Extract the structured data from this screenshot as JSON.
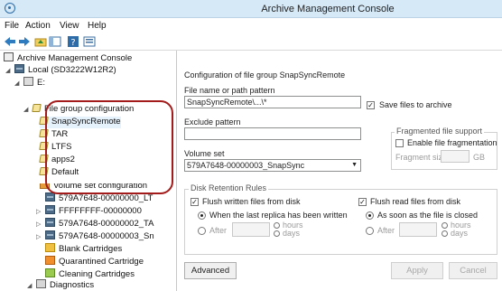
{
  "window": {
    "title": "Archive Management Console"
  },
  "menu": {
    "file": "File",
    "action": "Action",
    "view": "View",
    "help": "Help"
  },
  "toolbar": {
    "back": "arrow-left-icon",
    "forward": "arrow-right-icon",
    "up": "folder-up-icon",
    "show_hide": "show-hide-pane-icon",
    "help": "help-icon",
    "extra": "properties-icon"
  },
  "tree": {
    "root": "Archive Management Console",
    "local": "Local (SD3222W12R2)",
    "drive": "E:",
    "fgc": "File group configuration",
    "items": [
      "SnapSyncRemote",
      "TAR",
      "LTFS",
      "apps2",
      "Default"
    ],
    "volume_set_config": "Volume set configuration",
    "volume_sets": [
      "579A7648-00000000_LT",
      "FFFFFFFF-00000000",
      "579A7648-00000002_TA",
      "579A7648-00000003_Sn"
    ],
    "blank": "Blank Cartridges",
    "quarantined": "Quarantined Cartridge",
    "cleaning": "Cleaning Cartridges",
    "diagnostics": "Diagnostics"
  },
  "form": {
    "heading": "Configuration of file group  SnapSyncRemote",
    "file_name_label": "File name or path pattern",
    "file_name_value": "SnapSyncRemote\\...\\*",
    "save_files_label": "Save files to archive",
    "save_files_checked": true,
    "exclude_label": "Exclude pattern",
    "exclude_value": "",
    "frag_group": "Fragmented file support",
    "frag_enable_label": "Enable file fragmentation",
    "frag_enable_checked": false,
    "frag_size_label": "Fragment size",
    "frag_size_value": "",
    "frag_unit": "GB",
    "volume_set_label": "Volume set",
    "volume_set_value": "579A7648-00000003_SnapSync",
    "retention_group": "Disk Retention Rules",
    "flush_written_label": "Flush written files from disk",
    "flush_written_checked": true,
    "flush_read_label": "Flush read files from disk",
    "flush_read_checked": true,
    "written_last_replica": "When the last replica has been written",
    "written_after": "After",
    "written_hours": "hours",
    "written_days": "days",
    "read_closed": "As soon as the file is closed",
    "read_after": "After",
    "read_hours": "hours",
    "read_days": "days",
    "advanced": "Advanced",
    "apply": "Apply",
    "cancel": "Cancel"
  }
}
